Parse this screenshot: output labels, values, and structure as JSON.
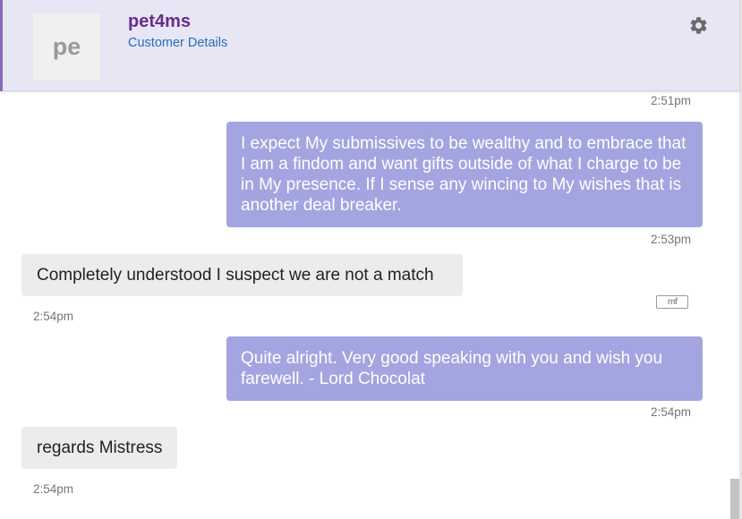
{
  "header": {
    "avatar_initials": "pe",
    "username": "pet4ms",
    "subtitle_link": "Customer Details",
    "settings_icon": "gear-icon"
  },
  "messages": [
    {
      "time": "2:51pm"
    },
    {
      "direction": "outgoing",
      "text": "I expect My submissives to be wealthy and to embrace that I am a findom and want gifts outside of what I charge to be in My presence. If I sense any wincing to My wishes that is another deal breaker.",
      "time": "2:53pm"
    },
    {
      "direction": "incoming",
      "text": "Completely understood I suspect we are not a match",
      "time": "2:54pm"
    },
    {
      "direction": "outgoing",
      "text": "Quite alright. Very good speaking with you and wish you farewell. - Lord Chocolat",
      "time": "2:54pm"
    },
    {
      "direction": "incoming",
      "text": "regards Mistress",
      "time": "2:54pm"
    }
  ],
  "badge": {
    "label": "mf",
    "icon": "mf-logo-icon"
  },
  "colors": {
    "header_bg": "#e6e6f5",
    "username": "#6a2c8a",
    "link": "#2b6cb8",
    "outgoing_bubble": "#a2a5df",
    "incoming_bubble": "#ececec"
  }
}
